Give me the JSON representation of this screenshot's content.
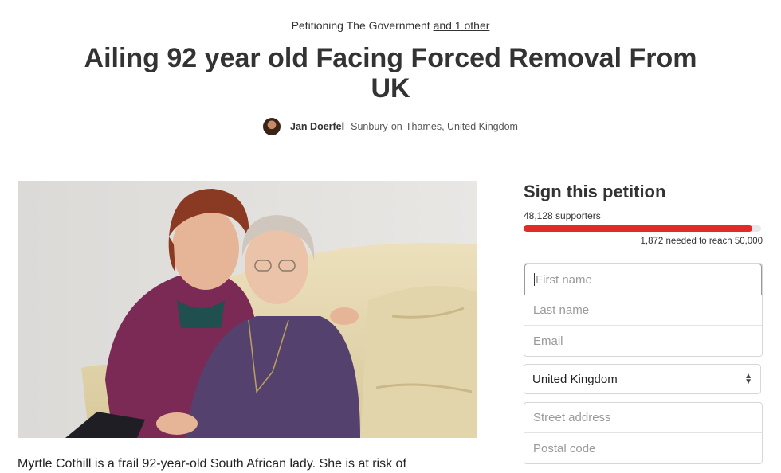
{
  "header": {
    "petitioning_prefix": "Petitioning The Government",
    "petitioning_link": "and 1 other",
    "title": "Ailing 92 year old Facing Forced Removal From UK",
    "author_name": "Jan Doerfel",
    "author_location": "Sunbury-on-Thames, United Kingdom"
  },
  "description": "Myrtle Cothill is a frail 92-year-old South African lady. She is at risk of",
  "sign": {
    "heading": "Sign this petition",
    "supporters": "48,128 supporters",
    "progress_fraction": 0.96256,
    "needed": "1,872 needed to reach 50,000",
    "first_name_placeholder": "First name",
    "last_name_placeholder": "Last name",
    "email_placeholder": "Email",
    "country_value": "United Kingdom",
    "street_placeholder": "Street address",
    "postal_placeholder": "Postal code"
  },
  "colors": {
    "progress_fill": "#e02b27",
    "progress_track": "#e8e8e8"
  }
}
